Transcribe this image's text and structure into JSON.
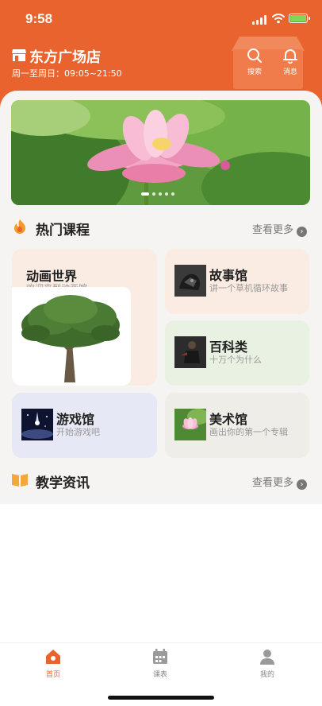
{
  "status_bar": {
    "time": "9:58"
  },
  "header": {
    "store_name": "东方广场店",
    "hours": "周一至周日：09:05~21:50",
    "search_label": "搜索",
    "message_label": "消息",
    "accent_color": "#e8632e"
  },
  "banner": {
    "image": "pink-lotus-photo",
    "slide_count": 5,
    "active_slide": 1
  },
  "hot_courses": {
    "title": "热门课程",
    "more": "查看更多",
    "cards": [
      {
        "title": "动画世界",
        "subtitle": "欢迎来到动画馆",
        "thumb": "tree-image"
      },
      {
        "title": "故事馆",
        "subtitle": "讲一个草机循环故事",
        "thumb": "dark-creature-image"
      },
      {
        "title": "百科类",
        "subtitle": "十万个为什么",
        "thumb": "dark-figure-image"
      },
      {
        "title": "游戏馆",
        "subtitle": "开始游戏吧",
        "thumb": "night-sky-image"
      },
      {
        "title": "美术馆",
        "subtitle": "画出你的第一个专辑",
        "thumb": "lotus-image"
      }
    ]
  },
  "news": {
    "title": "教学资讯",
    "more": "查看更多"
  },
  "tabbar": {
    "items": [
      {
        "label": "首页",
        "icon": "home-icon",
        "active": true
      },
      {
        "label": "课表",
        "icon": "calendar-icon",
        "active": false
      },
      {
        "label": "我的",
        "icon": "user-icon",
        "active": false
      }
    ]
  }
}
